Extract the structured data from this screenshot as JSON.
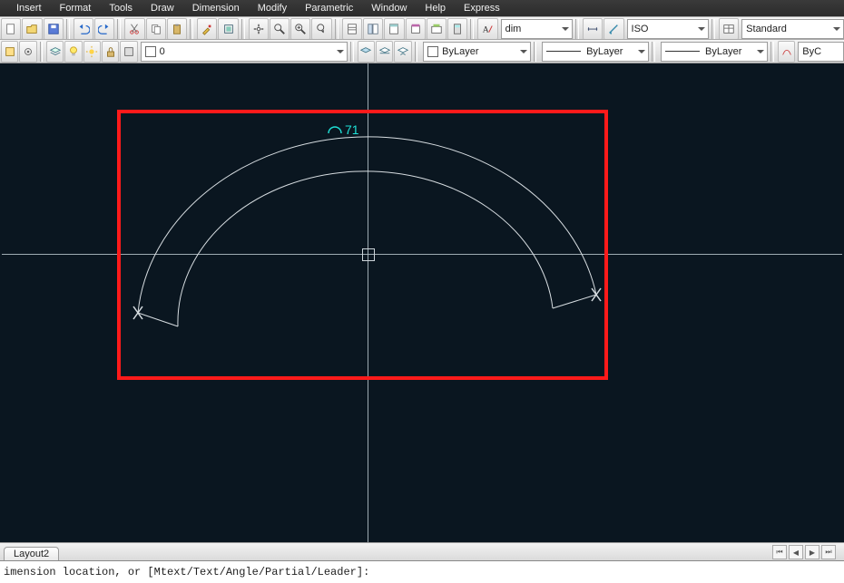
{
  "menu": {
    "items": [
      "Insert",
      "Format",
      "Tools",
      "Draw",
      "Dimension",
      "Modify",
      "Parametric",
      "Window",
      "Help",
      "Express"
    ]
  },
  "toolbarRow1": {
    "dim_style_label": "dim",
    "text_style_label": "ISO",
    "table_style_label": "Standard"
  },
  "toolbarRow2": {
    "layer_label": "0",
    "color_label": "ByLayer",
    "linetype_label": "ByLayer",
    "lineweight_label": "ByLayer",
    "plotstyle_label": "ByC"
  },
  "drawing": {
    "dim_value": "71"
  },
  "layoutTabs": {
    "active": "Layout2"
  },
  "command": {
    "prompt": "imension location, or [Mtext/Text/Angle/Partial/Leader]:"
  }
}
